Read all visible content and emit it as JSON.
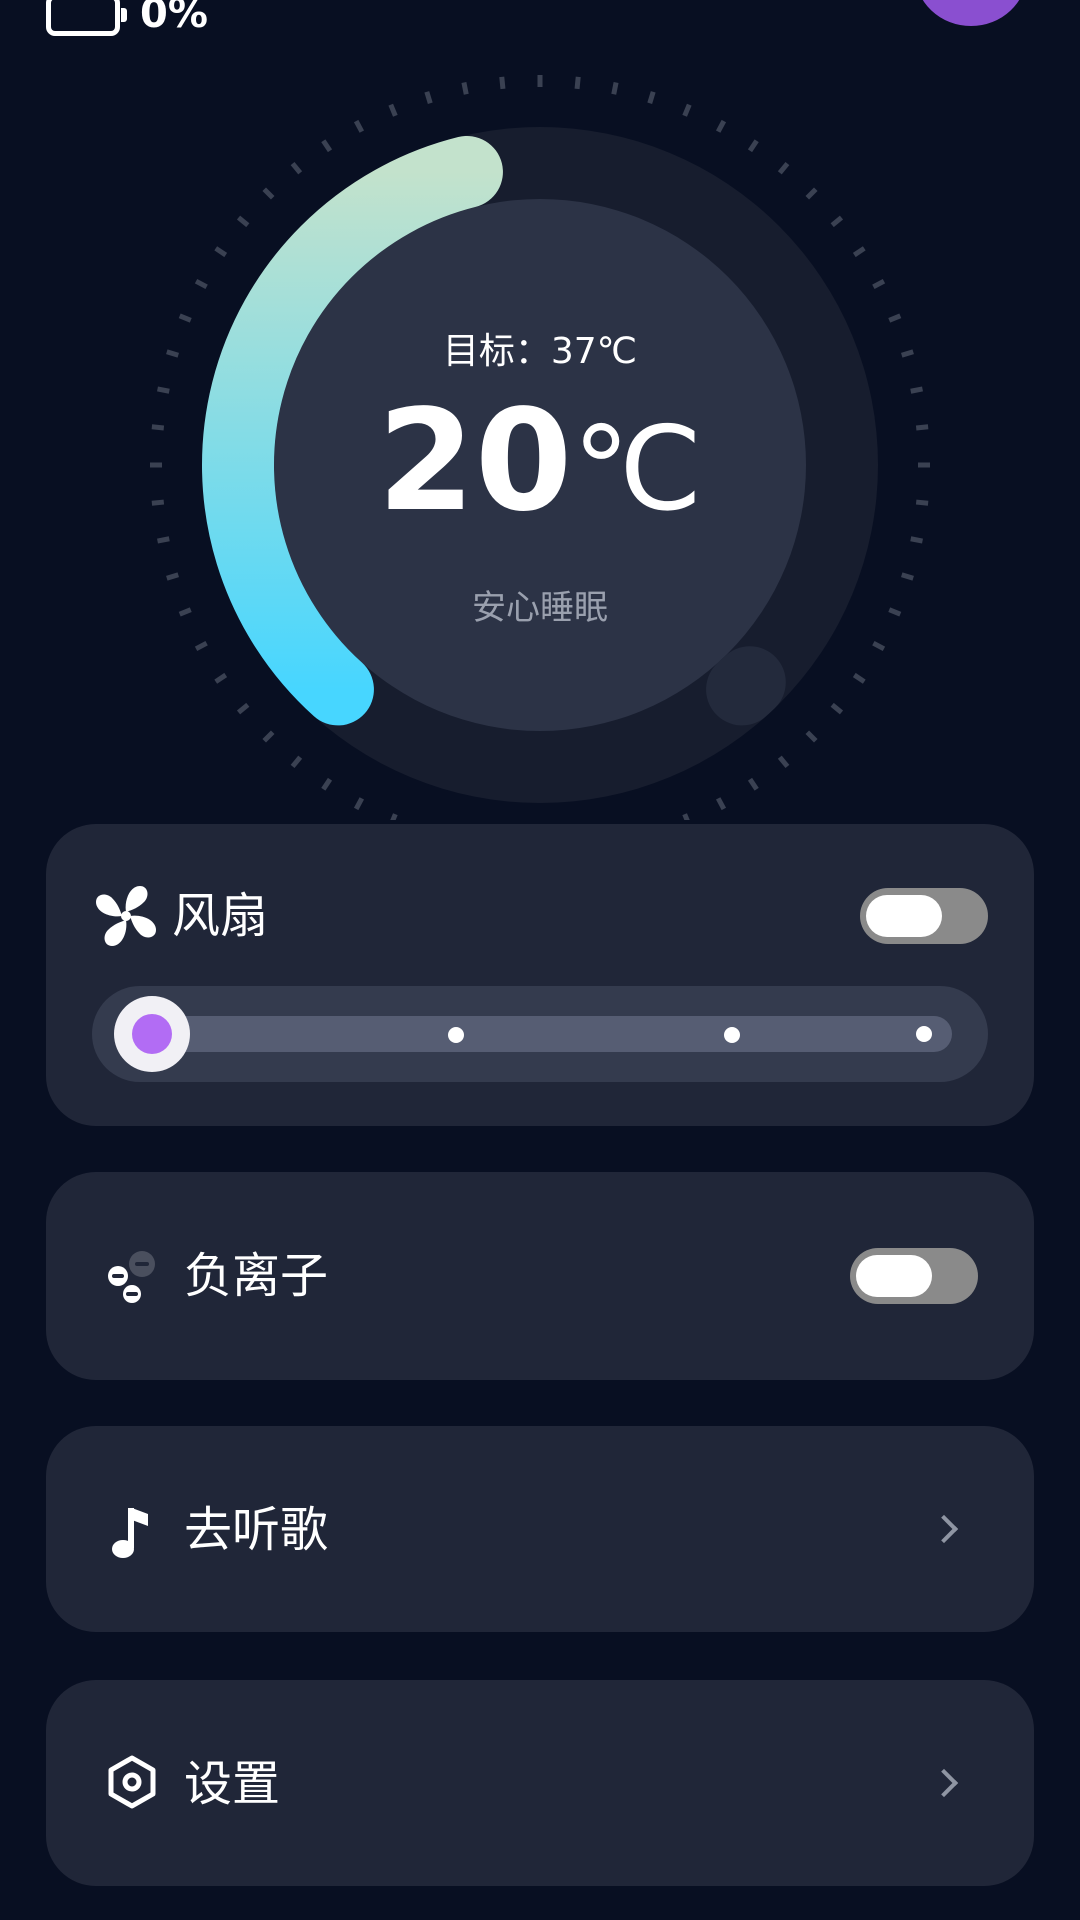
{
  "status_bar": {
    "battery_percent": "0%",
    "battery_level": 0.0,
    "avatar_color": "#8a4fd0"
  },
  "thermostat": {
    "target_label": "目标：37℃",
    "current_value": "20",
    "current_unit": "℃",
    "mode_label": "安心睡眠",
    "arc_gradient": [
      "#c3e2cc",
      "#47d6ff"
    ]
  },
  "fan_card": {
    "icon": "fan-icon",
    "label": "风扇",
    "toggle_on": false,
    "speed_levels": 4,
    "speed_level": 1,
    "accent_color": "#b26cf4"
  },
  "anion_card": {
    "icon": "negative-ion-icon",
    "label": "负离子",
    "toggle_on": false
  },
  "music_card": {
    "icon": "music-note-icon",
    "label": "去听歌"
  },
  "settings_card": {
    "icon": "settings-hexagon-icon",
    "label": "设置"
  }
}
